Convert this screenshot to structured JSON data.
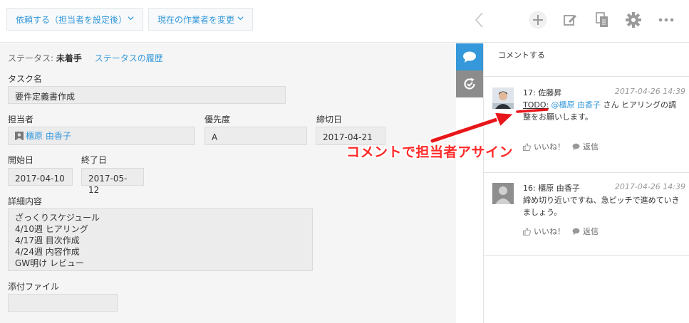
{
  "toolbar": {
    "request_button": "依頼する（担当者を設定後）",
    "change_worker_button": "現在の作業者を変更",
    "icons": [
      "chevron-left-icon",
      "plus-icon",
      "edit-icon",
      "copy-icon",
      "gear-icon",
      "more-icon"
    ]
  },
  "status": {
    "label": "ステータス:",
    "value": "未着手",
    "history_link": "ステータスの履歴"
  },
  "form": {
    "task_name_label": "タスク名",
    "task_name_value": "要件定義書作成",
    "assignee_label": "担当者",
    "assignee_value": "櫃原 由香子",
    "priority_label": "優先度",
    "priority_value": "A",
    "due_label": "締切日",
    "due_value": "2017-04-21",
    "start_label": "開始日",
    "start_value": "2017-04-10",
    "end_label": "終了日",
    "end_value": "2017-05-12",
    "detail_label": "詳細内容",
    "detail_lines": [
      "ざっくりスケジュール",
      "4/10週 ヒアリング",
      "4/17週 目次作成",
      "4/24週 内容作成",
      "GW明け レビュー"
    ],
    "attachment_label": "添付ファイル"
  },
  "comments": {
    "input_placeholder": "コメントする",
    "items": [
      {
        "author": "17: 佐藤昇",
        "date": "2017-04-26 14:39",
        "todo": "TODO:",
        "mention": "@櫃原 由香子",
        "body": " さん ヒアリングの調整をお願いします。",
        "like": "いいね！",
        "reply": "返信"
      },
      {
        "author": "16: 櫃原 由香子",
        "date": "2017-04-26 14:39",
        "body": "締め切り近いですね、急ピッチで進めていきましょう。",
        "like": "いいね！",
        "reply": "返信"
      }
    ]
  },
  "annotation": {
    "text": "コメントで担当者アサイン",
    "color": "#ff2a2a"
  },
  "colors": {
    "accent": "#3498db",
    "sidetab_active": "#3498db",
    "sidetab_inactive": "#8c8c8c"
  }
}
